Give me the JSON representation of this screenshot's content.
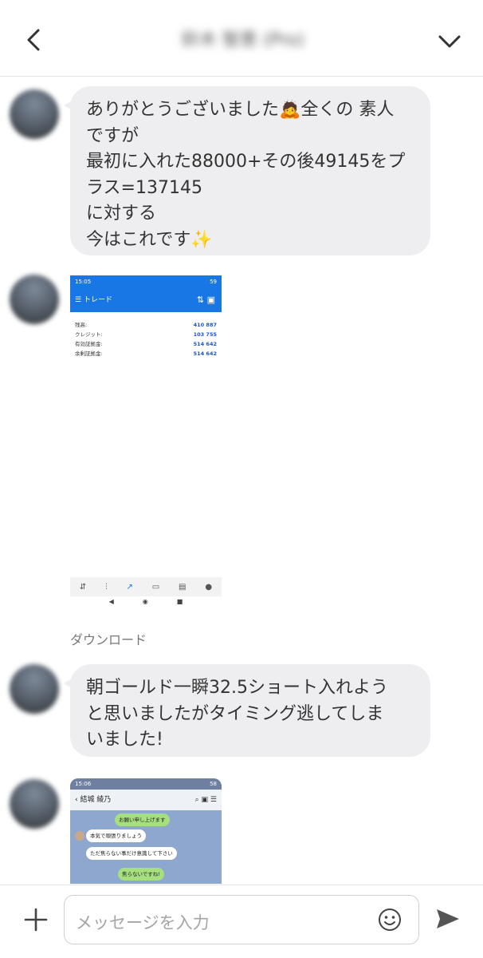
{
  "header": {
    "title": "鈴木 智恵 (Pro)",
    "back_icon": "chevron-left-icon",
    "menu_icon": "chevron-down-icon"
  },
  "messages": [
    {
      "type": "text",
      "lines": [
        "ありがとうございました",
        "全くの 素人",
        "ですが",
        "最初に入れた88000+その後49145をプ",
        "ラス=137145",
        "に対する",
        "今はこれです"
      ],
      "emojis": [
        "🙇",
        "✨"
      ]
    },
    {
      "type": "image",
      "screenshot": {
        "status_time": "15:05",
        "status_right": "59",
        "header_label": "トレード",
        "rows": [
          {
            "label": "残高:",
            "value": "410 887"
          },
          {
            "label": "クレジット:",
            "value": "103 755"
          },
          {
            "label": "有効証拠金:",
            "value": "514 642"
          },
          {
            "label": "余剰証拠金:",
            "value": "514 642"
          }
        ],
        "nav_glyphs": [
          "◀",
          "◉",
          "■"
        ]
      },
      "caption": "ダウンロード"
    },
    {
      "type": "text",
      "lines": [
        "朝ゴールド一瞬32.5ショート入れよう",
        "と思いましたがタイミング逃してしま",
        "いました!"
      ]
    },
    {
      "type": "image",
      "screenshot": {
        "status_time": "15:06",
        "status_right": "58",
        "header_name": "結城 綾乃",
        "bubbles": [
          "お願い申し上げます",
          "本気で頑張りましょう",
          "ただ焦らない事だけ意識して下さい",
          "焦らないですね!"
        ]
      }
    }
  ],
  "footer": {
    "placeholder": "メッセージを入力",
    "plus_icon": "plus-icon",
    "emoji_icon": "smile-icon",
    "send_icon": "send-icon"
  },
  "colors": {
    "bubble_bg": "#eeeef0",
    "accent_blue": "#1877e5",
    "line_green": "#a6e07e"
  }
}
